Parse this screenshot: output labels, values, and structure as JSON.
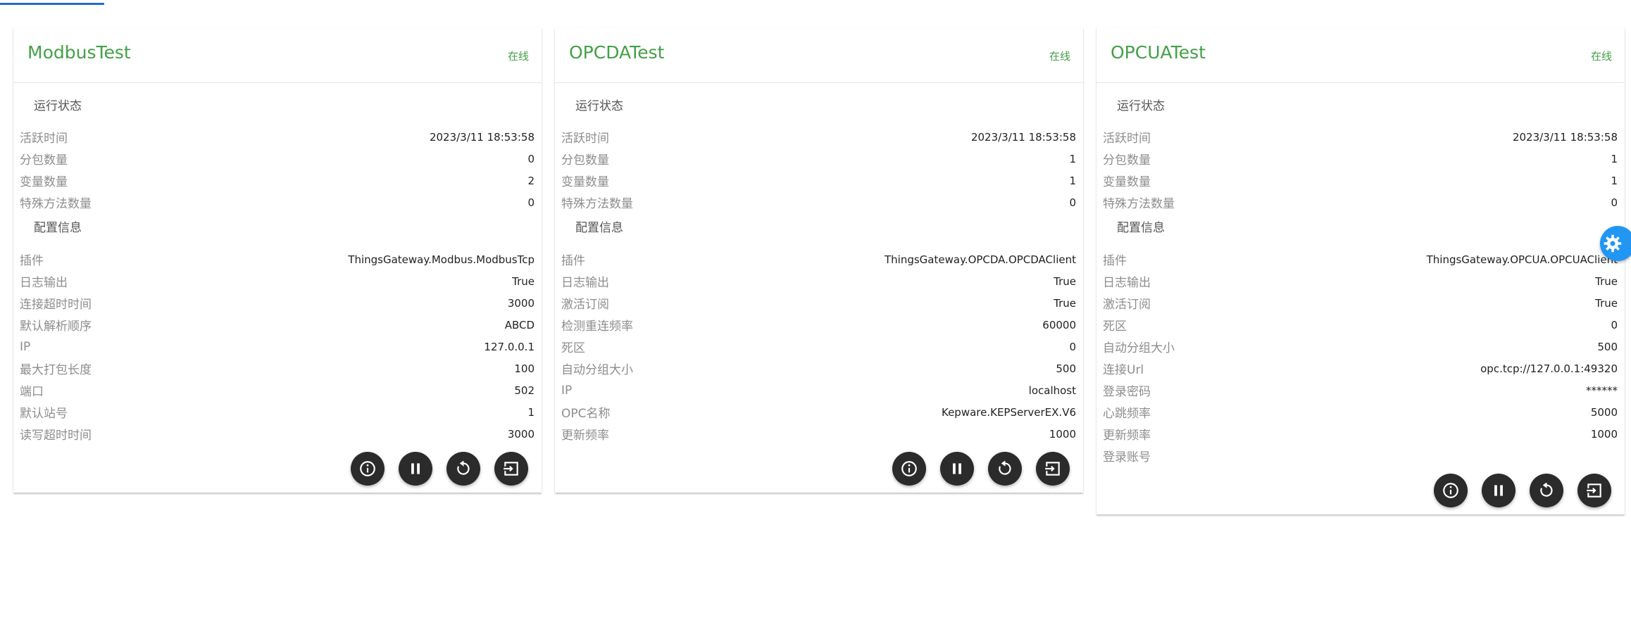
{
  "cards": [
    {
      "title": "ModbusTest",
      "status": "在线",
      "runtime_title": "运行状态",
      "runtime": [
        {
          "k": "活跃时间",
          "v": "2023/3/11 18:53:58"
        },
        {
          "k": "分包数量",
          "v": "0"
        },
        {
          "k": "变量数量",
          "v": "2"
        },
        {
          "k": "特殊方法数量",
          "v": "0"
        }
      ],
      "config_title": "配置信息",
      "config": [
        {
          "k": "插件",
          "v": "ThingsGateway.Modbus.ModbusTcp"
        },
        {
          "k": "日志输出",
          "v": "True"
        },
        {
          "k": "连接超时时间",
          "v": "3000"
        },
        {
          "k": "默认解析顺序",
          "v": "ABCD"
        },
        {
          "k": "IP",
          "v": "127.0.0.1"
        },
        {
          "k": "最大打包长度",
          "v": "100"
        },
        {
          "k": "端口",
          "v": "502"
        },
        {
          "k": "默认站号",
          "v": "1"
        },
        {
          "k": "读写超时时间",
          "v": "3000"
        }
      ]
    },
    {
      "title": "OPCDATest",
      "status": "在线",
      "runtime_title": "运行状态",
      "runtime": [
        {
          "k": "活跃时间",
          "v": "2023/3/11 18:53:58"
        },
        {
          "k": "分包数量",
          "v": "1"
        },
        {
          "k": "变量数量",
          "v": "1"
        },
        {
          "k": "特殊方法数量",
          "v": "0"
        }
      ],
      "config_title": "配置信息",
      "config": [
        {
          "k": "插件",
          "v": "ThingsGateway.OPCDA.OPCDAClient"
        },
        {
          "k": "日志输出",
          "v": "True"
        },
        {
          "k": "激活订阅",
          "v": "True"
        },
        {
          "k": "检测重连频率",
          "v": "60000"
        },
        {
          "k": "死区",
          "v": "0"
        },
        {
          "k": "自动分组大小",
          "v": "500"
        },
        {
          "k": "IP",
          "v": "localhost"
        },
        {
          "k": "OPC名称",
          "v": "Kepware.KEPServerEX.V6"
        },
        {
          "k": "更新频率",
          "v": "1000"
        }
      ]
    },
    {
      "title": "OPCUATest",
      "status": "在线",
      "runtime_title": "运行状态",
      "runtime": [
        {
          "k": "活跃时间",
          "v": "2023/3/11 18:53:58"
        },
        {
          "k": "分包数量",
          "v": "1"
        },
        {
          "k": "变量数量",
          "v": "1"
        },
        {
          "k": "特殊方法数量",
          "v": "0"
        }
      ],
      "config_title": "配置信息",
      "config": [
        {
          "k": "插件",
          "v": "ThingsGateway.OPCUA.OPCUAClient"
        },
        {
          "k": "日志输出",
          "v": "True"
        },
        {
          "k": "激活订阅",
          "v": "True"
        },
        {
          "k": "死区",
          "v": "0"
        },
        {
          "k": "自动分组大小",
          "v": "500"
        },
        {
          "k": "连接Url",
          "v": "opc.tcp://127.0.0.1:49320"
        },
        {
          "k": "登录密码",
          "v": "******"
        },
        {
          "k": "心跳频率",
          "v": "5000"
        },
        {
          "k": "更新频率",
          "v": "1000"
        },
        {
          "k": "登录账号",
          "v": ""
        }
      ]
    }
  ],
  "icons": {
    "info": "info-icon",
    "pause": "pause-icon",
    "restart": "restart-icon",
    "logout": "exit-icon",
    "settings": "gear-icon"
  },
  "colors": {
    "title_green": "#43a047",
    "button_dark": "#2b2b2b",
    "fab_blue": "#2196f3",
    "top_indicator": "#1e6fc8"
  }
}
